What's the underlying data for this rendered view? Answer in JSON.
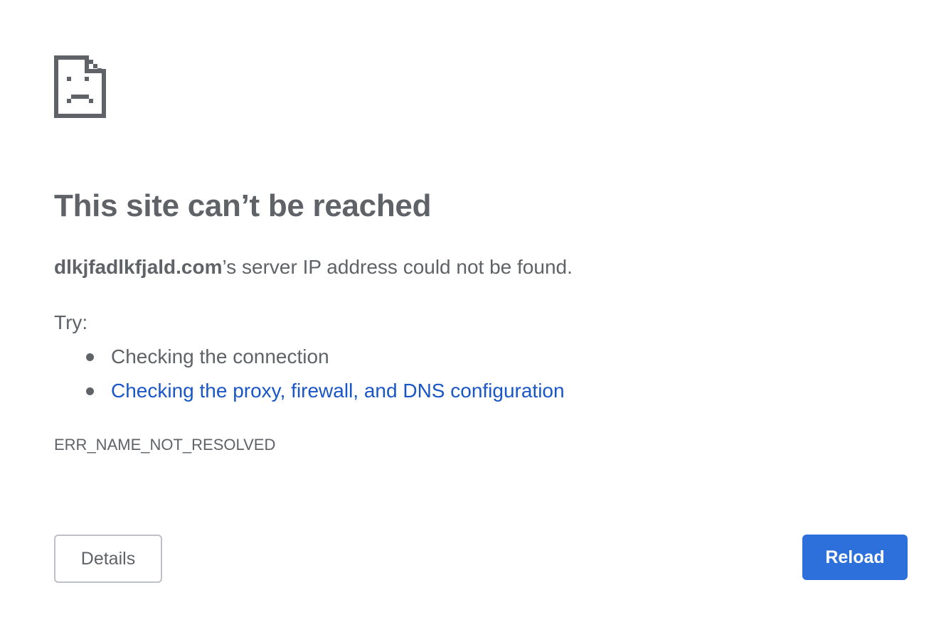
{
  "icon": {
    "name": "sad-page-icon"
  },
  "error": {
    "title": "This site can’t be reached",
    "host": "dlkjfadlkfjald.com",
    "message_suffix": "’s server IP address could not be found.",
    "try_label": "Try:",
    "suggestions": [
      {
        "text": "Checking the connection",
        "is_link": false
      },
      {
        "text": "Checking the proxy, firewall, and DNS configuration",
        "is_link": true
      }
    ],
    "code": "ERR_NAME_NOT_RESOLVED"
  },
  "buttons": {
    "details_label": "Details",
    "reload_label": "Reload"
  },
  "colors": {
    "text": "#5f6368",
    "link": "#1a56c6",
    "primary_button": "#2d6fdb",
    "button_border": "#bdc1c6"
  }
}
